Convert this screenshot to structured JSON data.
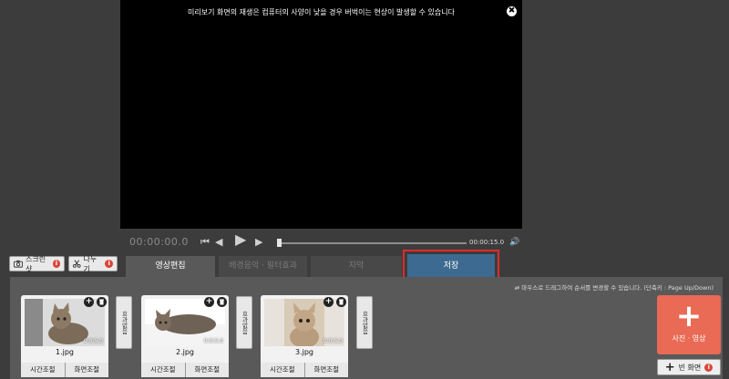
{
  "preview": {
    "notice": "미리보기 화면의 재생은 컴퓨터의 사양이 낮을 경우 버벅이는 현상이 발생할 수 있습니다",
    "close_icon": "✖"
  },
  "player": {
    "current_time": "00:00:00.0",
    "end_time": "00:00:15.0",
    "prev_icon": "⏮",
    "rewind_icon": "◀",
    "play_icon": "▶",
    "forward_icon": "▶",
    "volume_icon": "🔊"
  },
  "toolbar": {
    "screenshot_label": "스크린샷",
    "split_label": "나누기",
    "info_glyph": "i"
  },
  "tabs": {
    "edit": "영상편집",
    "music": "배경음악 · 필터효과",
    "subtitle": "자막",
    "save": "저장"
  },
  "panel": {
    "hint": "⇄ 마우스로 드래그하여 순서를 변경할 수 있습니다. (단축키 : Page Up/Down)"
  },
  "clips": [
    {
      "name": "1.jpg",
      "duration": "0:0:5.0",
      "time_btn": "시간조절",
      "screen_btn": "화면조절"
    },
    {
      "name": "2.jpg",
      "duration": "0:0:5.0",
      "time_btn": "시간조절",
      "screen_btn": "화면조절"
    },
    {
      "name": "3.jpg",
      "duration": "0:0:5.0",
      "time_btn": "시간조절",
      "screen_btn": "화면조절"
    }
  ],
  "effect_label": "효과없음",
  "clip_add_glyph": "+",
  "add_media": {
    "plus": "+",
    "label": "사진 · 영상"
  },
  "blank_screen": {
    "plus": "+",
    "label": "빈 화면"
  },
  "colors": {
    "background": "#3c3c3c",
    "panel": "#595959",
    "save_tab": "#3d6a90",
    "highlight": "#e02b2b",
    "add_media": "#e96a55",
    "info_badge": "#d9453a"
  }
}
